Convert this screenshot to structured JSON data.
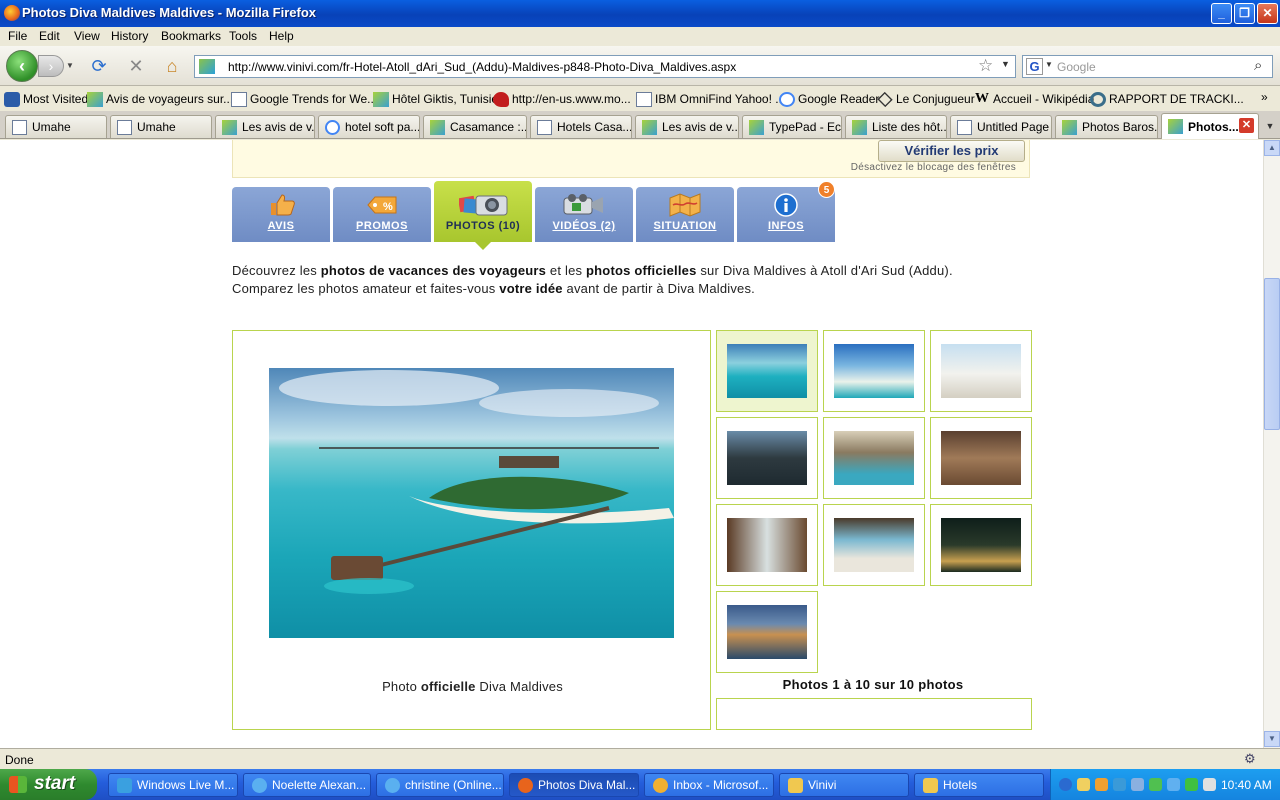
{
  "window": {
    "title": "Photos Diva Maldives Maldives - Mozilla Firefox",
    "buttons": [
      "_",
      "❐",
      "✕"
    ]
  },
  "menu": [
    "File",
    "Edit",
    "View",
    "History",
    "Bookmarks",
    "Tools",
    "Help"
  ],
  "nav": {
    "url": "http://www.vinivi.com/fr-Hotel-Atoll_dAri_Sud_(Addu)-Maldives-p848-Photo-Diva_Maldives.aspx",
    "search_placeholder": "Google"
  },
  "bookmarks": [
    {
      "label": "Most Visited",
      "icon": "blue"
    },
    {
      "label": "Avis de voyageurs sur...",
      "icon": "green"
    },
    {
      "label": "Google Trends for We...",
      "icon": "page"
    },
    {
      "label": "Hôtel Giktis, Tunisie",
      "icon": "green"
    },
    {
      "label": "http://en-us.www.mo...",
      "icon": "red"
    },
    {
      "label": "IBM OmniFind Yahoo! ...",
      "icon": "page"
    },
    {
      "label": "Google Reader",
      "icon": "gg"
    },
    {
      "label": "Le Conjugueur",
      "icon": "dia"
    },
    {
      "label": "Accueil - Wikipédia",
      "icon": "wk"
    },
    {
      "label": "RAPPORT DE TRACKI...",
      "icon": "ring"
    }
  ],
  "tabs": [
    {
      "label": "Umahe",
      "icon": "page"
    },
    {
      "label": "Umahe",
      "icon": "page"
    },
    {
      "label": "Les avis de v...",
      "icon": "green"
    },
    {
      "label": "hotel soft pa...",
      "icon": "gg"
    },
    {
      "label": "Casamance :...",
      "icon": "green"
    },
    {
      "label": "Hotels Casa...",
      "icon": "page"
    },
    {
      "label": "Les avis de v...",
      "icon": "green"
    },
    {
      "label": "TypePad - Ec...",
      "icon": "green"
    },
    {
      "label": "Liste des hôt...",
      "icon": "green"
    },
    {
      "label": "Untitled Page",
      "icon": "page"
    },
    {
      "label": "Photos Baros...",
      "icon": "green"
    },
    {
      "label": "Photos...",
      "icon": "green",
      "active": true
    }
  ],
  "page": {
    "verify_button": "Vérifier les prix",
    "popup_note": "Désactivez le blocage des fenêtres",
    "nav_tabs": [
      {
        "label": "AVIS",
        "icon": "thumb-up-icon"
      },
      {
        "label": "PROMOS",
        "icon": "tag-icon"
      },
      {
        "label": "PHOTOS (10)",
        "icon": "camera-icon",
        "active": true
      },
      {
        "label": "VIDÉOS (2)",
        "icon": "video-camera-icon"
      },
      {
        "label": "SITUATION",
        "icon": "map-icon"
      },
      {
        "label": "INFOS",
        "icon": "info-icon"
      }
    ],
    "infos_badge": "5",
    "intro": {
      "l1_a": "Découvrez les ",
      "l1_b": "photos de vacances des voyageurs",
      "l1_c": " et les ",
      "l1_d": "photos officielles",
      "l1_e": " sur Diva Maldives à Atoll d'Ari Sud (Addu).",
      "l2_a": "Comparez les photos amateur et faites-vous ",
      "l2_b": "votre idée",
      "l2_c": " avant de partir à Diva Maldives."
    },
    "caption": {
      "a": "Photo ",
      "b": "officielle",
      "c": " Diva Maldives"
    },
    "photo_count": "Photos 1 à 10 sur 10 photos"
  },
  "status": "Done",
  "taskbar": {
    "start": "start",
    "items": [
      {
        "label": "Windows Live M...",
        "color": "#3aa0e0"
      },
      {
        "label": "Noelette Alexan...",
        "color": "#5ab0f0"
      },
      {
        "label": "christine (Online...",
        "color": "#5ab0f0"
      },
      {
        "label": "Photos Diva Mal...",
        "color": "#e8641c",
        "active": true
      },
      {
        "label": "Inbox - Microsof...",
        "color": "#f0b030"
      },
      {
        "label": "Vinivi",
        "color": "#f0c850"
      },
      {
        "label": "Hotels",
        "color": "#f0c850"
      }
    ],
    "clock": "10:40 AM"
  }
}
